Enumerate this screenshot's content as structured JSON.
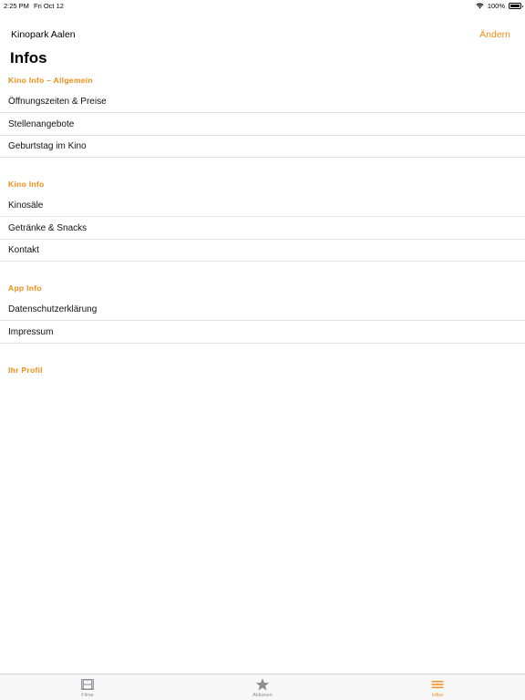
{
  "status_bar": {
    "time": "2:25 PM",
    "date": "Fri Oct 12",
    "battery": "100%"
  },
  "nav": {
    "cinema_name": "Kinopark Aalen",
    "change_label": "Ändern"
  },
  "page": {
    "title": "Infos"
  },
  "sections": [
    {
      "header": "Kino Info – Allgemein",
      "items": [
        "Öffnungszeiten & Preise",
        "Stellenangebote",
        "Geburtstag im Kino"
      ]
    },
    {
      "header": "Kino Info",
      "items": [
        "Kinosäle",
        "Getränke & Snacks",
        "Kontakt"
      ]
    },
    {
      "header": "App Info",
      "items": [
        "Datenschutzerklärung",
        "Impressum"
      ]
    },
    {
      "header": "Ihr Profil",
      "items": []
    }
  ],
  "tab_bar": {
    "tabs": [
      {
        "label": "Filme",
        "icon": "film-icon",
        "active": false
      },
      {
        "label": "Aktionen",
        "icon": "star-icon",
        "active": false
      },
      {
        "label": "Infos",
        "icon": "menu-icon",
        "active": true
      }
    ]
  },
  "colors": {
    "accent": "#f28c14",
    "separator": "#e3e3e6",
    "tab_inactive": "#8e8e93"
  }
}
